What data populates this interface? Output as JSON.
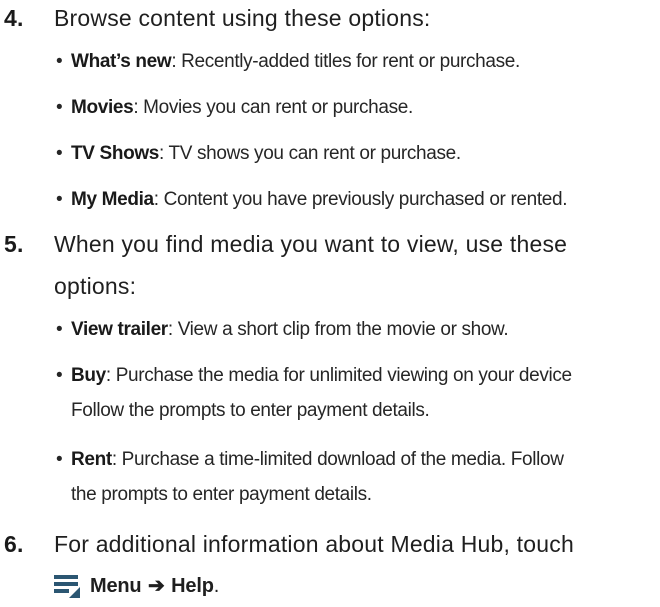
{
  "steps": [
    {
      "number": "4.",
      "text": "Browse content using these options:",
      "bullets": [
        {
          "term": "What’s new",
          "desc": ": Recently-added titles for rent or purchase."
        },
        {
          "term": "Movies",
          "desc": ": Movies you can rent or purchase."
        },
        {
          "term": "TV Shows",
          "desc": ": TV shows you can rent or purchase."
        },
        {
          "term": "My Media",
          "desc": ": Content you have previously purchased or rented."
        }
      ]
    },
    {
      "number": "5.",
      "text_line1": "When you find media you want to view, use these",
      "text_line2": "options:",
      "bullets": [
        {
          "term": "View trailer",
          "desc": ": View a short clip from the movie or show."
        },
        {
          "term": "Buy",
          "desc": ": Purchase the media for unlimited viewing on your device",
          "cont": "Follow the prompts to enter payment details."
        },
        {
          "term": "Rent",
          "desc": ": Purchase a time-limited download of the media. Follow",
          "cont": "the prompts to enter payment details."
        }
      ]
    },
    {
      "number": "6.",
      "text": "For additional information about Media Hub, touch",
      "menu_label": "Menu",
      "arrow": "➔",
      "help_label": "Help",
      "end_punct": ".",
      "icon": "menu-icon"
    }
  ],
  "colors": {
    "text": "#1f1f1f",
    "icon": "#2b5672"
  }
}
